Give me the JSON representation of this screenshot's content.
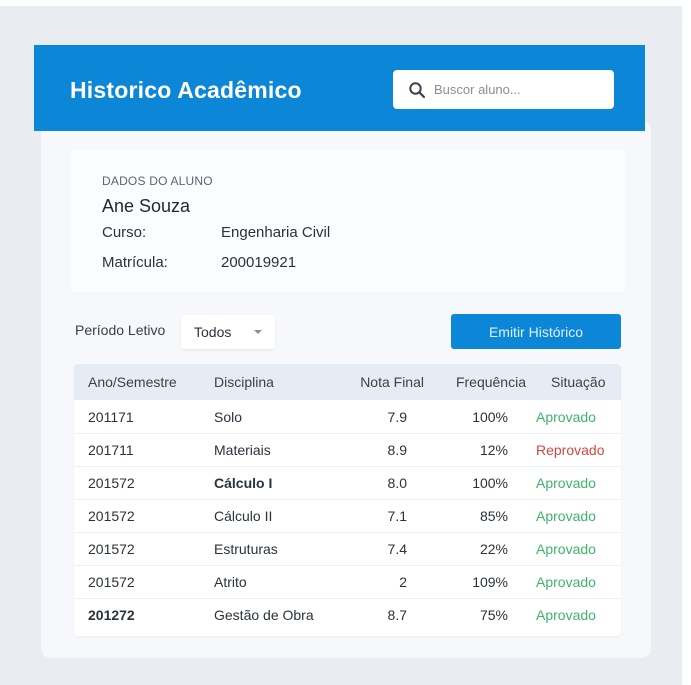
{
  "header": {
    "title": "Historico Acadêmico"
  },
  "search": {
    "placeholder": "Buscor aluno...",
    "icon": "search-icon"
  },
  "student": {
    "section_label": "DADOS DO ALUNO",
    "name": "Ane Souza",
    "course_label": "Curso:",
    "course_value": "Engenharia Civil",
    "registration_label": "Matrícula:",
    "registration_value": "200019921"
  },
  "filter": {
    "label": "Período Letivo",
    "selected": "Todos"
  },
  "actions": {
    "emit_label": "Emitir Histórico"
  },
  "table": {
    "columns": [
      "Ano/Semestre",
      "Disciplina",
      "Nota Final",
      "Frequência",
      "Situação"
    ],
    "rows": [
      {
        "ano": "201171",
        "disciplina": "Solo",
        "nota": "7.9",
        "frequencia": "100%",
        "situacao": "Aprovado"
      },
      {
        "ano": "201711",
        "disciplina": "Materiais",
        "nota": "8.9",
        "frequencia": "12%",
        "situacao": "Reprovado"
      },
      {
        "ano": "201572",
        "disciplina": "Cálculo I",
        "nota": "8.0",
        "frequencia": "100%",
        "situacao": "Aprovado"
      },
      {
        "ano": "201572",
        "disciplina": "Cálculo II",
        "nota": "7.1",
        "frequencia": "85%",
        "situacao": "Aprovado"
      },
      {
        "ano": "201572",
        "disciplina": "Estruturas",
        "nota": "7.4",
        "frequencia": "22%",
        "situacao": "Aprovado"
      },
      {
        "ano": "201572",
        "disciplina": "Atrito",
        "nota": "2",
        "frequencia": "109%",
        "situacao": "Aprovado"
      },
      {
        "ano": "201272",
        "disciplina": "Gestão de Obra",
        "nota": "8.7",
        "frequencia": "75%",
        "situacao": "Aprovado"
      }
    ]
  },
  "colors": {
    "accent": "#0c87d8",
    "approved": "#3fb36b",
    "failed": "#d2483e"
  }
}
